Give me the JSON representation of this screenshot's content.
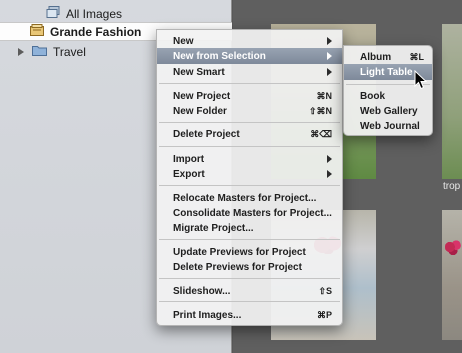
{
  "sidebar": {
    "items": [
      {
        "label": "All Images",
        "icon": "image-stack-icon"
      },
      {
        "label": "Grande Fashion",
        "icon": "project-icon",
        "selected": true
      },
      {
        "label": "Travel",
        "icon": "folder-icon"
      }
    ]
  },
  "browser": {
    "thumb_label": "trop"
  },
  "menu": {
    "items": [
      {
        "label": "New",
        "submenu": true
      },
      {
        "label": "New from Selection",
        "submenu": true,
        "highlighted": true
      },
      {
        "label": "New Smart",
        "submenu": true
      },
      {
        "label": "New Project",
        "shortcut": "⌘N"
      },
      {
        "label": "New Folder",
        "shortcut": "⇧⌘N"
      },
      {
        "label": "Delete Project",
        "shortcut": "⌘⌫"
      },
      {
        "label": "Import",
        "submenu": true
      },
      {
        "label": "Export",
        "submenu": true
      },
      {
        "label": "Relocate Masters for Project..."
      },
      {
        "label": "Consolidate Masters for Project..."
      },
      {
        "label": "Migrate Project..."
      },
      {
        "label": "Update Previews for Project"
      },
      {
        "label": "Delete Previews for Project"
      },
      {
        "label": "Slideshow...",
        "shortcut": "⇧S"
      },
      {
        "label": "Print Images...",
        "shortcut": "⌘P"
      }
    ]
  },
  "submenu": {
    "items": [
      {
        "label": "Album",
        "shortcut": "⌘L"
      },
      {
        "label": "Light Table",
        "highlighted": true
      },
      {
        "label": "Book"
      },
      {
        "label": "Web Gallery"
      },
      {
        "label": "Web Journal"
      }
    ]
  },
  "colors": {
    "highlight": "#8a95a5",
    "sidebar_bg": "#d3d6db",
    "browser_bg": "#5f5f5f"
  }
}
